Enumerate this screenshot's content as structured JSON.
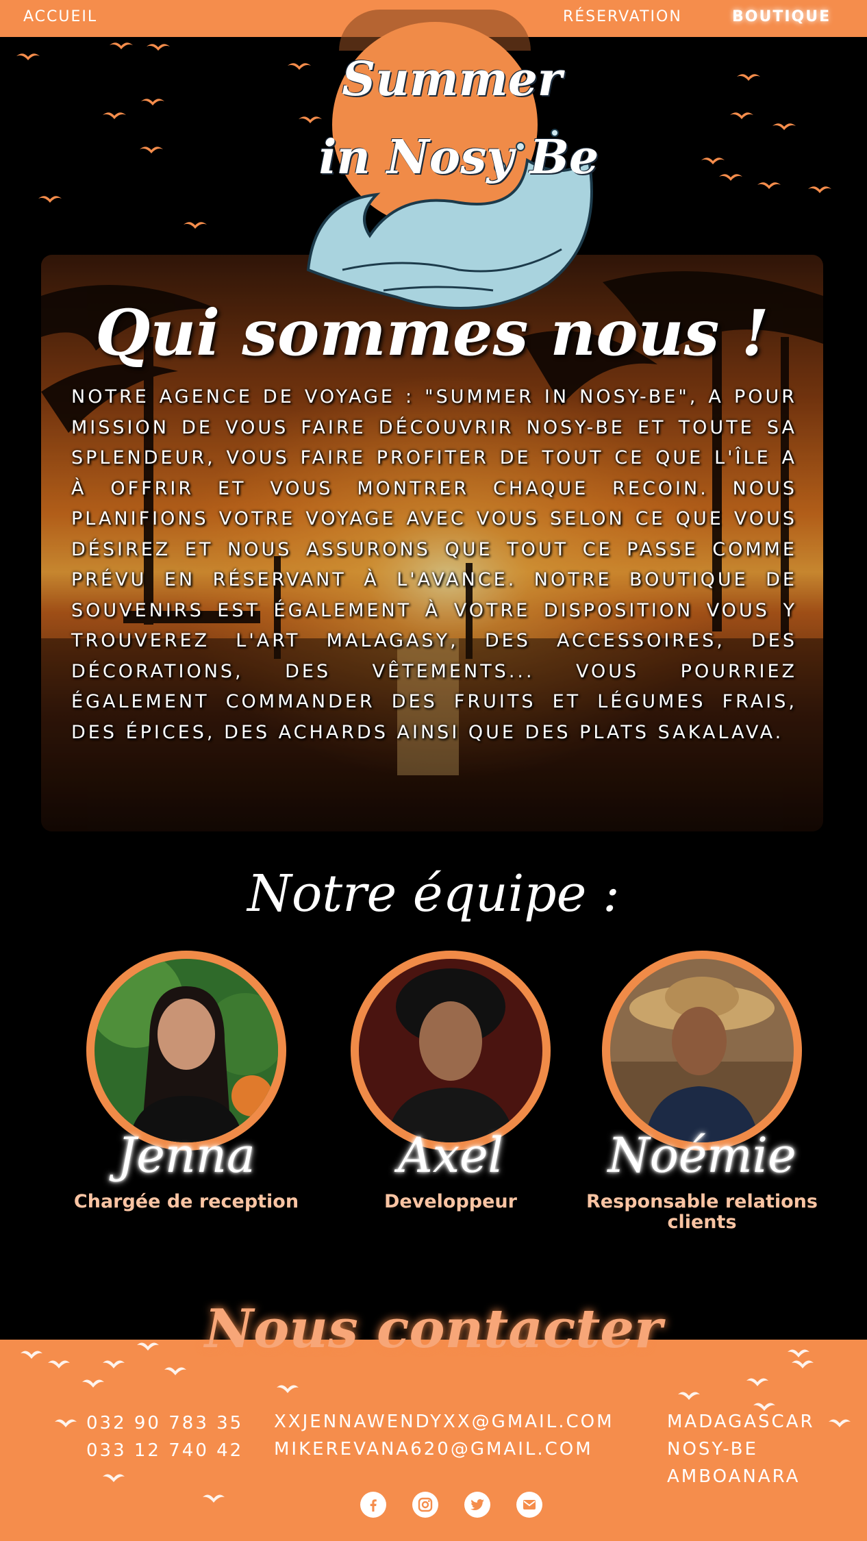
{
  "nav": {
    "home": "ACCUEIL",
    "reservation": "RÉSERVATION",
    "shop": "BOUTIQUE"
  },
  "logo": {
    "line1": "Summer",
    "line2": "in Nosy Be"
  },
  "about": {
    "title": "Qui sommes nous !",
    "text": "Notre agence de voyage : \"Summer in Nosy-Be\", a pour mission de vous faire découvrir Nosy-Be et toute sa splendeur, vous faire profiter de tout ce que l'île a à offrir et vous montrer chaque recoin. Nous planifions votre voyage avec vous selon ce que vous désirez et nous assurons que tout ce passe comme prévu en réservant à l'avance. Notre boutique de souvenirs est également à votre disposition vous y trouverez l'art malagasy, des accessoires, des décorations, des vêtements... vous pourriez également commander des fruits et légumes frais, des épices, des achards ainsi que des plats sakalava."
  },
  "team": {
    "title": "Notre équipe :",
    "members": [
      {
        "name": "Jenna",
        "role": "Chargée de reception"
      },
      {
        "name": "Axel",
        "role": "Developpeur"
      },
      {
        "name": "Noémie",
        "role": "Responsable relations clients"
      }
    ]
  },
  "contact": {
    "title": "Nous contacter",
    "phones": [
      "032 90 783 35",
      "033 12 740 42"
    ],
    "emails": [
      "XXJENNAWENDYXX@GMAIL.COM",
      "MIKEREVANA620@GMAIL.COM"
    ],
    "address": [
      "MADAGASCAR",
      "NOSY-BE",
      "AMBOANARA"
    ],
    "socials": [
      "facebook-icon",
      "instagram-icon",
      "twitter-icon",
      "mail-icon"
    ]
  },
  "colors": {
    "accent": "#f58d4c",
    "background": "#000000",
    "role_text": "#f9c4a3"
  }
}
